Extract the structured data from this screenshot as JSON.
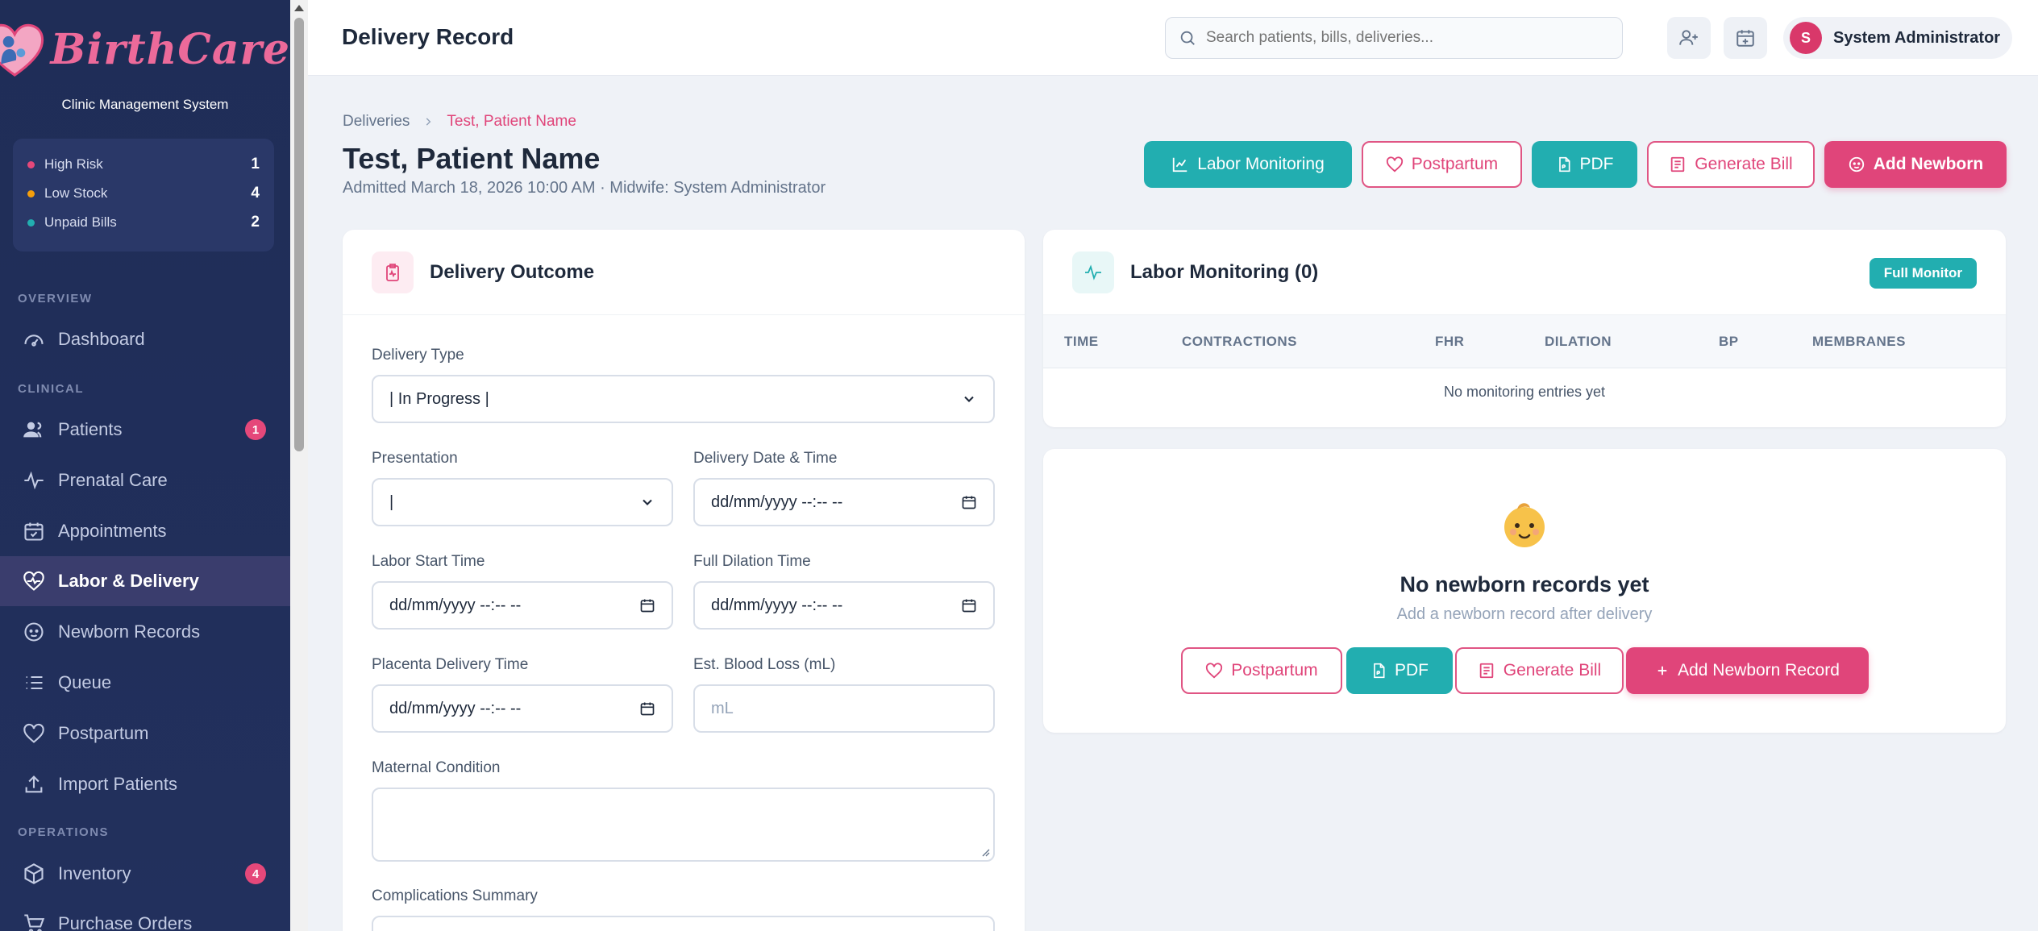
{
  "brand": {
    "name": "BirthCare",
    "subtitle": "Clinic Management System"
  },
  "alerts": [
    {
      "label": "High Risk",
      "count": "1",
      "color": "#e5487a"
    },
    {
      "label": "Low Stock",
      "count": "4",
      "color": "#f59e0b"
    },
    {
      "label": "Unpaid Bills",
      "count": "2",
      "color": "#22aeb0"
    }
  ],
  "nav": {
    "sections": {
      "overview": "OVERVIEW",
      "clinical": "CLINICAL",
      "operations": "OPERATIONS"
    },
    "items": [
      {
        "label": "Dashboard",
        "icon": "gauge-icon"
      },
      {
        "label": "Patients",
        "icon": "users-icon",
        "badge": "1"
      },
      {
        "label": "Prenatal Care",
        "icon": "activity-icon"
      },
      {
        "label": "Appointments",
        "icon": "calendar-check-icon"
      },
      {
        "label": "Labor & Delivery",
        "icon": "heart-pulse-icon",
        "active": true
      },
      {
        "label": "Newborn Records",
        "icon": "baby-face-icon"
      },
      {
        "label": "Queue",
        "icon": "list-icon"
      },
      {
        "label": "Postpartum",
        "icon": "heart-icon"
      },
      {
        "label": "Import Patients",
        "icon": "upload-icon"
      },
      {
        "label": "Inventory",
        "icon": "box-icon",
        "badge": "4"
      },
      {
        "label": "Purchase Orders",
        "icon": "cart-icon"
      }
    ]
  },
  "header": {
    "title": "Delivery Record",
    "search_placeholder": "Search patients, bills, deliveries...",
    "user_initial": "S",
    "user_name": "System Administrator"
  },
  "breadcrumb": {
    "parent": "Deliveries",
    "current": "Test, Patient Name"
  },
  "patient": {
    "name": "Test, Patient Name",
    "subtitle": "Admitted March 18, 2026 10:00 AM · Midwife: System Administrator"
  },
  "actions": {
    "labor_monitoring": "Labor Monitoring",
    "postpartum": "Postpartum",
    "pdf": "PDF",
    "generate_bill": "Generate Bill",
    "add_newborn": "Add Newborn"
  },
  "delivery_outcome": {
    "title": "Delivery Outcome",
    "delivery_type_label": "Delivery Type",
    "delivery_type_value": "| In Progress |",
    "presentation_label": "Presentation",
    "presentation_value": "|",
    "delivery_datetime_label": "Delivery Date & Time",
    "labor_start_label": "Labor Start Time",
    "full_dilation_label": "Full Dilation Time",
    "placenta_label": "Placenta Delivery Time",
    "blood_loss_label": "Est. Blood Loss (mL)",
    "blood_loss_placeholder": "mL",
    "datetime_placeholder": "dd/mm/yyyy --:-- --",
    "maternal_condition_label": "Maternal Condition",
    "complications_label": "Complications Summary"
  },
  "labor_monitoring": {
    "title": "Labor Monitoring (0)",
    "badge": "Full Monitor",
    "columns": [
      "TIME",
      "CONTRACTIONS",
      "FHR",
      "DILATION",
      "BP",
      "MEMBRANES"
    ],
    "empty_text": "No monitoring entries yet"
  },
  "newborn": {
    "emoji": "👶",
    "title": "No newborn records yet",
    "subtitle": "Add a newborn record after delivery",
    "postpartum": "Postpartum",
    "pdf": "PDF",
    "generate_bill": "Generate Bill",
    "add_record": "Add Newborn Record"
  },
  "colors": {
    "teal": "#22aeb0",
    "pink": "#e0457a",
    "navy": "#1f2d57"
  }
}
